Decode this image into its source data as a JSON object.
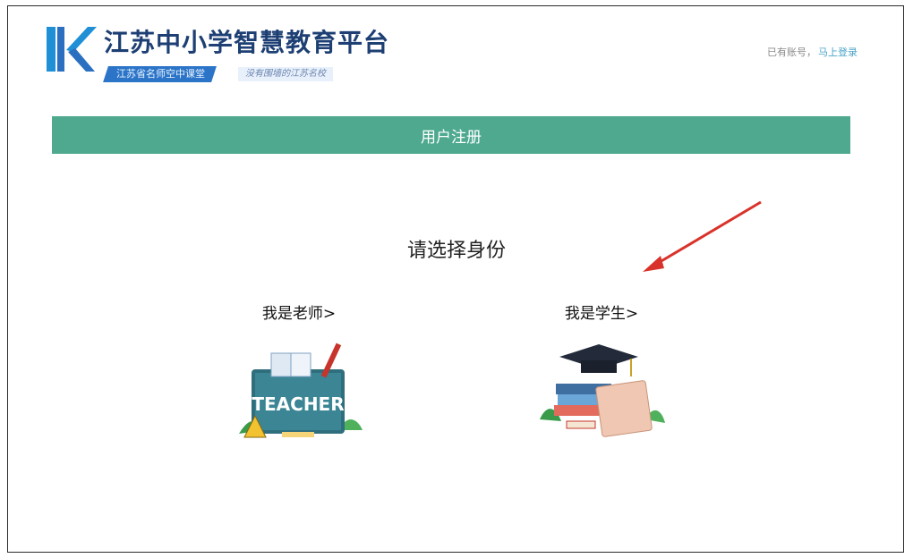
{
  "header": {
    "title": "江苏中小学智慧教育平台",
    "tagline_primary": "江苏省名师空中课堂",
    "tagline_secondary": "没有围墙的江苏名校",
    "login_prefix": "已有账号，",
    "login_link": "马上登录"
  },
  "banner": {
    "label": "用户注册"
  },
  "main": {
    "prompt": "请选择身份",
    "roles": [
      {
        "label": "我是老师>",
        "illustration_text": "TEACHER"
      },
      {
        "label": "我是学生>"
      }
    ]
  },
  "colors": {
    "brand_blue": "#1d3f73",
    "banner_green": "#4ea98f",
    "arrow_red": "#d9322a"
  }
}
